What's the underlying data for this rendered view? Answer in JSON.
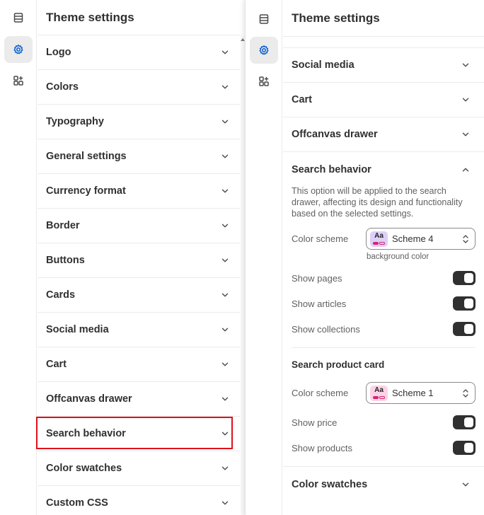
{
  "left": {
    "title": "Theme settings",
    "items": [
      {
        "label": "Logo"
      },
      {
        "label": "Colors"
      },
      {
        "label": "Typography"
      },
      {
        "label": "General settings"
      },
      {
        "label": "Currency format"
      },
      {
        "label": "Border"
      },
      {
        "label": "Buttons"
      },
      {
        "label": "Cards"
      },
      {
        "label": "Social media"
      },
      {
        "label": "Cart"
      },
      {
        "label": "Offcanvas drawer"
      },
      {
        "label": "Search behavior"
      },
      {
        "label": "Color swatches"
      },
      {
        "label": "Custom CSS"
      }
    ],
    "highlighted_item": "Search behavior"
  },
  "right": {
    "title": "Theme settings",
    "items": [
      {
        "label": "Social media"
      },
      {
        "label": "Cart"
      },
      {
        "label": "Offcanvas drawer"
      }
    ],
    "expanded": {
      "label": "Search behavior",
      "description": "This option will be applied to the search drawer, affecting its design and functionality based on the selected settings.",
      "color_scheme": {
        "label": "Color scheme",
        "value": "Scheme 4",
        "swatch_text": "Aa",
        "swatch_bg": "#ddd0f8",
        "swatch_accent": "#d6246e",
        "hint": "background color"
      },
      "toggles": [
        {
          "label": "Show pages",
          "on": true
        },
        {
          "label": "Show articles",
          "on": true
        },
        {
          "label": "Show collections",
          "on": true
        }
      ],
      "product_card": {
        "heading": "Search product card",
        "color_scheme": {
          "label": "Color scheme",
          "value": "Scheme 1",
          "swatch_text": "Aa",
          "swatch_bg": "#fbd3e6",
          "swatch_accent": "#d6246e"
        },
        "toggles": [
          {
            "label": "Show price",
            "on": true
          },
          {
            "label": "Show products",
            "on": true
          }
        ]
      }
    },
    "after_items": [
      {
        "label": "Color swatches"
      }
    ]
  },
  "rail": {
    "icons": [
      "sections-icon",
      "settings-gear-icon",
      "apps-icon"
    ],
    "active": "settings-gear-icon",
    "accent_color": "#005bd3"
  }
}
